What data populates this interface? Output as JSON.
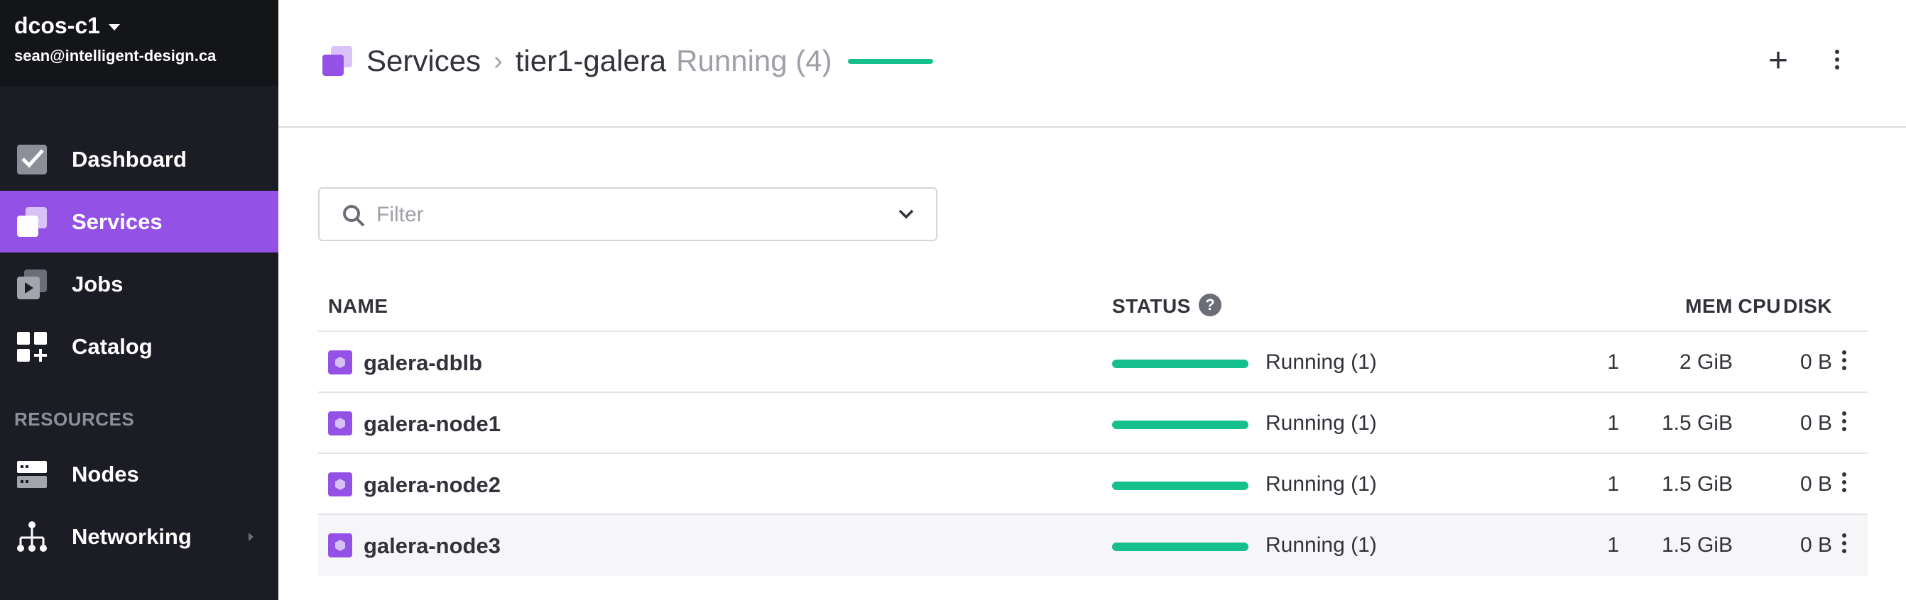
{
  "sidebar": {
    "cluster_name": "dcos-c1",
    "user_email": "sean@intelligent-design.ca",
    "nav": [
      {
        "label": "Dashboard",
        "icon": "dashboard-icon"
      },
      {
        "label": "Services",
        "icon": "services-icon",
        "active": true
      },
      {
        "label": "Jobs",
        "icon": "jobs-icon"
      },
      {
        "label": "Catalog",
        "icon": "catalog-icon"
      }
    ],
    "resources_label": "RESOURCES",
    "resources": [
      {
        "label": "Nodes",
        "icon": "nodes-icon"
      },
      {
        "label": "Networking",
        "icon": "networking-icon"
      }
    ]
  },
  "header": {
    "breadcrumb_root": "Services",
    "breadcrumb_separator": "›",
    "service_name": "tier1-galera",
    "service_status": "Running (4)",
    "add_label": "+"
  },
  "filter": {
    "placeholder": "Filter"
  },
  "table": {
    "columns": {
      "name": "NAME",
      "status": "STATUS",
      "help": "?",
      "cpu": "CPU",
      "mem": "MEM",
      "disk": "DISK"
    },
    "rows": [
      {
        "name": "galera-dblb",
        "status": "Running (1)",
        "cpu": "1",
        "mem": "2 GiB",
        "disk": "0 B"
      },
      {
        "name": "galera-node1",
        "status": "Running (1)",
        "cpu": "1",
        "mem": "1.5 GiB",
        "disk": "0 B"
      },
      {
        "name": "galera-node2",
        "status": "Running (1)",
        "cpu": "1",
        "mem": "1.5 GiB",
        "disk": "0 B"
      },
      {
        "name": "galera-node3",
        "status": "Running (1)",
        "cpu": "1",
        "mem": "1.5 GiB",
        "disk": "0 B"
      }
    ]
  },
  "colors": {
    "accent": "#9352e5",
    "sidebar_bg": "#1b1c24",
    "status_ok": "#16c08c"
  }
}
